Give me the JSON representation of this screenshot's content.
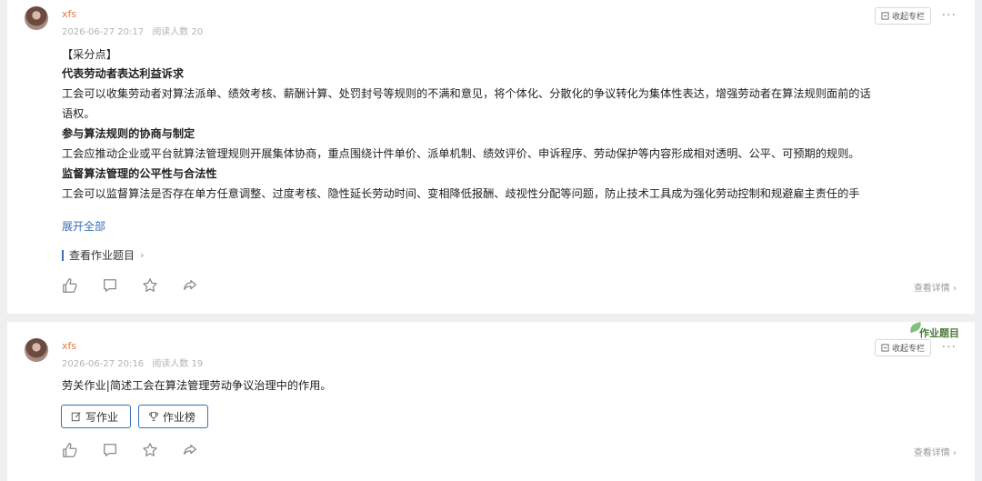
{
  "posts": [
    {
      "author": "xfs",
      "date": "2026-06-27 20:17",
      "views": "阅读人数 20",
      "collect_label": "收起专栏",
      "lines": [
        {
          "text": "【采分点】",
          "bold": false
        },
        {
          "text": "代表劳动者表达利益诉求",
          "bold": true
        },
        {
          "text": "工会可以收集劳动者对算法派单、绩效考核、薪酬计算、处罚封号等规则的不满和意见，将个体化、分散化的争议转化为集体性表达，增强劳动者在算法规则面前的话",
          "bold": false
        },
        {
          "text": "语权。",
          "bold": false
        },
        {
          "text": "参与算法规则的协商与制定",
          "bold": true
        },
        {
          "text": "工会应推动企业或平台就算法管理规则开展集体协商，重点围绕计件单价、派单机制、绩效评价、申诉程序、劳动保护等内容形成相对透明、公平、可预期的规则。",
          "bold": false
        },
        {
          "text": "监督算法管理的公平性与合法性",
          "bold": true
        },
        {
          "text": "工会可以监督算法是否存在单方任意调整、过度考核、隐性延长劳动时间、变相降低报酬、歧视性分配等问题，防止技术工具成为强化劳动控制和规避雇主责任的手",
          "bold": false
        }
      ],
      "expand_label": "展开全部",
      "view_task_label": "查看作业题目",
      "detail_label": "查看详情"
    },
    {
      "author": "xfs",
      "date": "2026-06-27 20:16",
      "views": "阅读人数 19",
      "collect_label": "收起专栏",
      "text": "劳关作业|简述工会在算法管理劳动争议治理中的作用。",
      "write_label": "写作业",
      "rank_label": "作业榜",
      "detail_label": "查看详情",
      "deco_tag": "作业题目"
    }
  ]
}
